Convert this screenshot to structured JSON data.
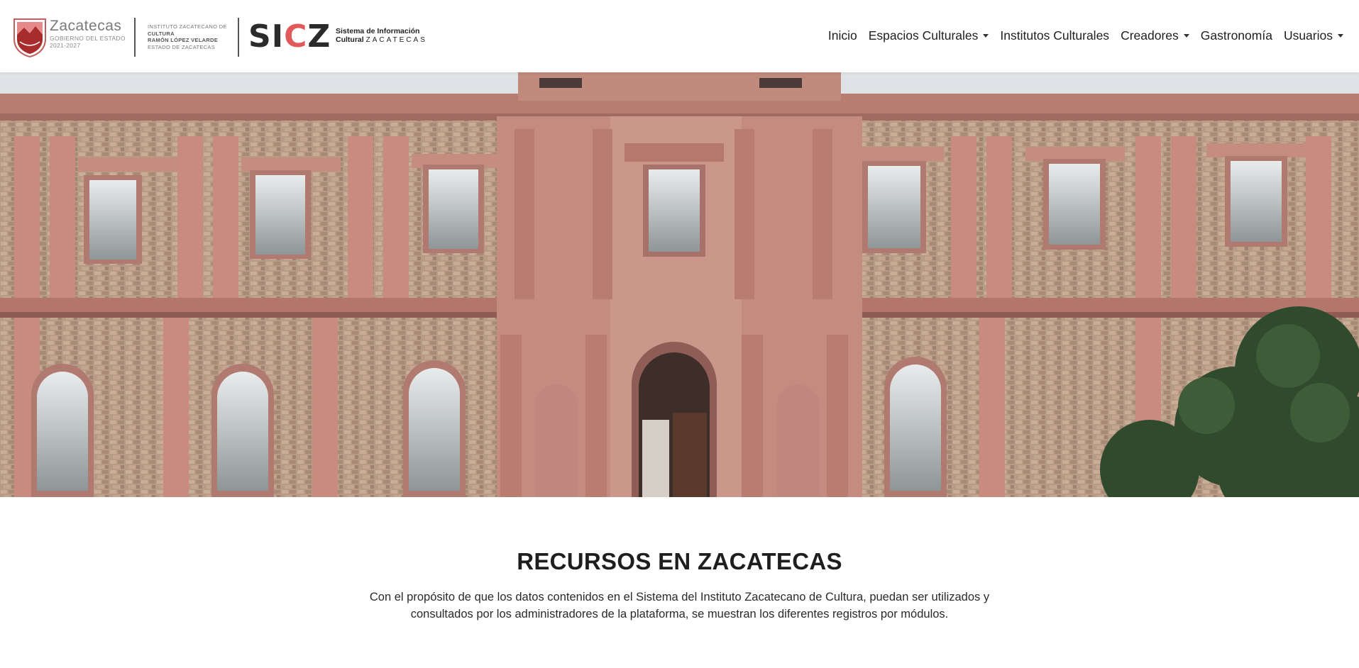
{
  "header": {
    "gov_logo": {
      "title": "Zacatecas",
      "subtitle": "GOBIERNO DEL ESTADO",
      "years": "2021-2027"
    },
    "institute_logo": {
      "line1": "INSTITUTO ZACATECANO DE",
      "line2": "CULTURA",
      "line3": "RAMÓN LÓPEZ VELARDE",
      "line4": "ESTADO DE ZACATECAS"
    },
    "sicz_logo": {
      "mark": "SICZ",
      "line1": "Sistema de Información",
      "line2a": "Cultural",
      "line2b": "ZACATECAS"
    },
    "colors": {
      "brand_red": "#e05a5a",
      "logo_dark_red": "#8b1e1e"
    }
  },
  "nav": {
    "items": [
      {
        "label": "Inicio",
        "dropdown": false
      },
      {
        "label": "Espacios Culturales",
        "dropdown": true
      },
      {
        "label": "Institutos Culturales",
        "dropdown": false
      },
      {
        "label": "Creadores",
        "dropdown": true
      },
      {
        "label": "Gastronomía",
        "dropdown": false
      },
      {
        "label": "Usuarios",
        "dropdown": true
      }
    ]
  },
  "main": {
    "title": "RECURSOS EN ZACATECAS",
    "description": "Con el propósito de que los datos contenidos en el Sistema del Instituto Zacatecano de Cultura, puedan ser utilizados y consultados por los administradores de la plataforma, se muestran los diferentes registros por módulos."
  }
}
